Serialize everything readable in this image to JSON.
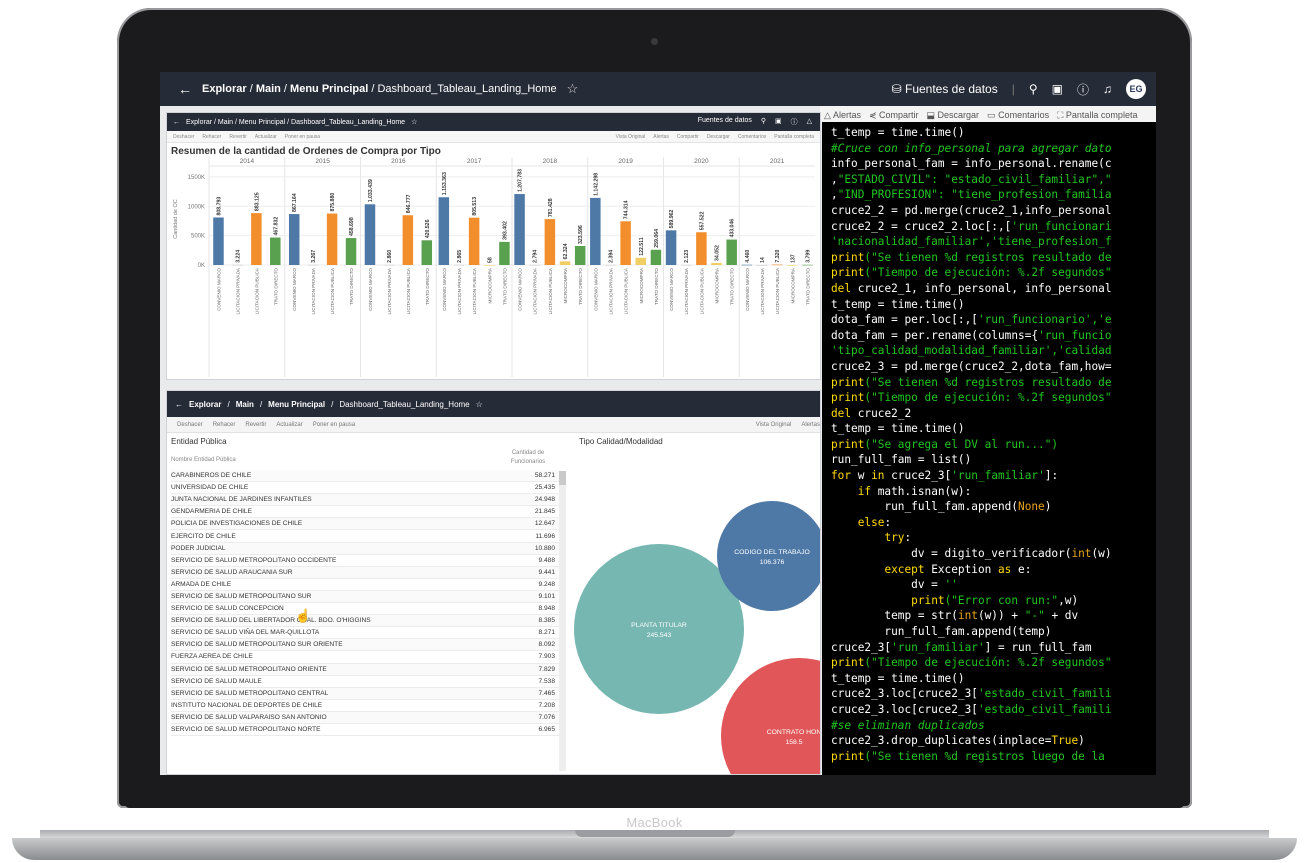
{
  "device": {
    "brand_label": "MacBook"
  },
  "topbar": {
    "breadcrumb": [
      "Explorar",
      "Main",
      "Menu Principal",
      "Dashboard_Tableau_Landing_Home"
    ],
    "data_sources": "Fuentes de datos",
    "avatar_initials": "EG"
  },
  "toolbar_right": [
    "Alertas",
    "Compartir",
    "Descargar",
    "Comentarios",
    "Pantalla completa"
  ],
  "panel1": {
    "topbar_crumb": "Explorar / Main / Menu Principal / Dashboard_Tableau_Landing_Home",
    "toolbar_left": [
      "Deshacer",
      "Rehacer",
      "Revertir",
      "Actualizar",
      "Poner en pausa"
    ],
    "toolbar_right": [
      "Vista Original",
      "Alertas",
      "Compartir",
      "Descargar",
      "Comentarios",
      "Pantalla completa"
    ],
    "data_sources": "Fuentes de datos"
  },
  "chart_data": {
    "type": "bar",
    "title": "Resumen de la cantidad de Ordenes de Compra por Tipo",
    "ylabel": "Cantidad de OC",
    "yticks": [
      "0K",
      "500K",
      "1000K",
      "1500K"
    ],
    "ylim": [
      0,
      1600000
    ],
    "colors": {
      "CONVENIO MARCO": "#4e79a7",
      "LICITACION PRIVADA": "#c9c9c9",
      "LICITACION PUBLICA": "#f28e2b",
      "TRATO DIRECTO": "#59a14f",
      "MICROCOMPRA": "#f1ce63"
    },
    "groups": [
      {
        "year": "2014",
        "bars": [
          {
            "cat": "CONVENIO MARCO",
            "value": 808793,
            "label": "808.793"
          },
          {
            "cat": "LICITACION PRIVADA",
            "value": 3224,
            "label": "3.224"
          },
          {
            "cat": "LICITACION PUBLICA",
            "value": 883125,
            "label": "883.125"
          },
          {
            "cat": "TRATO DIRECTO",
            "value": 467832,
            "label": "467.832"
          }
        ]
      },
      {
        "year": "2015",
        "bars": [
          {
            "cat": "CONVENIO MARCO",
            "value": 867164,
            "label": "867.164"
          },
          {
            "cat": "LICITACION PRIVADA",
            "value": 3267,
            "label": "3.267"
          },
          {
            "cat": "LICITACION PUBLICA",
            "value": 875880,
            "label": "875.880"
          },
          {
            "cat": "TRATO DIRECTO",
            "value": 458698,
            "label": "458.698"
          }
        ]
      },
      {
        "year": "2016",
        "bars": [
          {
            "cat": "CONVENIO MARCO",
            "value": 1033439,
            "label": "1.033.439"
          },
          {
            "cat": "LICITACION PRIVADA",
            "value": 2860,
            "label": "2.860"
          },
          {
            "cat": "LICITACION PUBLICA",
            "value": 846777,
            "label": "846.777"
          },
          {
            "cat": "TRATO DIRECTO",
            "value": 420526,
            "label": "420.526"
          }
        ]
      },
      {
        "year": "2017",
        "bars": [
          {
            "cat": "CONVENIO MARCO",
            "value": 1153363,
            "label": "1.153.363"
          },
          {
            "cat": "LICITACION PRIVADA",
            "value": 2865,
            "label": "2.865"
          },
          {
            "cat": "LICITACION PUBLICA",
            "value": 805513,
            "label": "805.513"
          },
          {
            "cat": "MICROCOMPRA",
            "value": 58,
            "label": "58"
          },
          {
            "cat": "TRATO DIRECTO",
            "value": 393402,
            "label": "393.402"
          }
        ]
      },
      {
        "year": "2018",
        "bars": [
          {
            "cat": "CONVENIO MARCO",
            "value": 1207783,
            "label": "1.207.783"
          },
          {
            "cat": "LICITACION PRIVADA",
            "value": 2794,
            "label": "2.794"
          },
          {
            "cat": "LICITACION PUBLICA",
            "value": 781428,
            "label": "781.428"
          },
          {
            "cat": "MICROCOMPRA",
            "value": 62324,
            "label": "62.324"
          },
          {
            "cat": "TRATO DIRECTO",
            "value": 323596,
            "label": "323.596"
          }
        ]
      },
      {
        "year": "2019",
        "bars": [
          {
            "cat": "CONVENIO MARCO",
            "value": 1142298,
            "label": "1.142.298"
          },
          {
            "cat": "LICITACION PRIVADA",
            "value": 2394,
            "label": "2.394"
          },
          {
            "cat": "LICITACION PUBLICA",
            "value": 744314,
            "label": "744.314"
          },
          {
            "cat": "MICROCOMPRA",
            "value": 122511,
            "label": "122.511"
          },
          {
            "cat": "TRATO DIRECTO",
            "value": 259064,
            "label": "259.064"
          }
        ]
      },
      {
        "year": "2020",
        "bars": [
          {
            "cat": "CONVENIO MARCO",
            "value": 589962,
            "label": "589.962"
          },
          {
            "cat": "LICITACION PRIVADA",
            "value": 2123,
            "label": "2.123"
          },
          {
            "cat": "LICITACION PUBLICA",
            "value": 557522,
            "label": "557.522"
          },
          {
            "cat": "MICROCOMPRA",
            "value": 34052,
            "label": "34.052"
          },
          {
            "cat": "TRATO DIRECTO",
            "value": 433046,
            "label": "433.046"
          }
        ]
      },
      {
        "year": "2021",
        "bars": [
          {
            "cat": "CONVENIO MARCO",
            "value": 4460,
            "label": "4.460"
          },
          {
            "cat": "LICITACION PRIVADA",
            "value": 14,
            "label": "14"
          },
          {
            "cat": "LICITACION PUBLICA",
            "value": 7320,
            "label": "7.320"
          },
          {
            "cat": "MICROCOMPRA",
            "value": 137,
            "label": "137"
          },
          {
            "cat": "TRATO DIRECTO",
            "value": 3799,
            "label": "3.799"
          }
        ]
      }
    ]
  },
  "panel2": {
    "topbar_crumb": [
      "Explorar",
      "Main",
      "Menu Principal",
      "Dashboard_Tableau_Landing_Home"
    ],
    "toolbar_left": [
      "Deshacer",
      "Rehacer",
      "Revertir",
      "Actualizar",
      "Poner en pausa"
    ],
    "toolbar_right": [
      "Vista Original",
      "Alertas"
    ],
    "entity_title": "Entidad Pública",
    "col_name": "Nombre Entidad Pública",
    "col_count": "Cantidad de Funcionarios",
    "tipo_title": "Tipo Calidad/Modalidad",
    "rows": [
      {
        "name": "CARABINEROS DE CHILE",
        "count": "58.271"
      },
      {
        "name": "UNIVERSIDAD DE CHILE",
        "count": "25.435"
      },
      {
        "name": "JUNTA NACIONAL DE JARDINES INFANTILES",
        "count": "24.948"
      },
      {
        "name": "GENDARMERIA DE CHILE",
        "count": "21.845"
      },
      {
        "name": "POLICIA DE INVESTIGACIONES DE CHILE",
        "count": "12.647"
      },
      {
        "name": "EJERCITO DE CHILE",
        "count": "11.696"
      },
      {
        "name": "PODER JUDICIAL",
        "count": "10.880"
      },
      {
        "name": "SERVICIO DE SALUD METROPOLITANO OCCIDENTE",
        "count": "9.488"
      },
      {
        "name": "SERVICIO DE SALUD ARAUCANIA SUR",
        "count": "9.441"
      },
      {
        "name": "ARMADA DE CHILE",
        "count": "9.248"
      },
      {
        "name": "SERVICIO DE SALUD METROPOLITANO SUR",
        "count": "9.101"
      },
      {
        "name": "SERVICIO DE SALUD CONCEPCION",
        "count": "8.948"
      },
      {
        "name": "SERVICIO DE SALUD DEL LIBERTADOR GRAL. BDO. O'HIGGINS",
        "count": "8.385"
      },
      {
        "name": "SERVICIO DE SALUD VIÑA DEL MAR-QUILLOTA",
        "count": "8.271"
      },
      {
        "name": "SERVICIO DE SALUD METROPOLITANO SUR ORIENTE",
        "count": "8.092"
      },
      {
        "name": "FUERZA AEREA DE CHILE",
        "count": "7.903"
      },
      {
        "name": "SERVICIO DE SALUD METROPOLITANO ORIENTE",
        "count": "7.829"
      },
      {
        "name": "SERVICIO DE SALUD MAULE",
        "count": "7.538"
      },
      {
        "name": "SERVICIO DE SALUD METROPOLITANO CENTRAL",
        "count": "7.465"
      },
      {
        "name": "INSTITUTO NACIONAL DE DEPORTES DE CHILE",
        "count": "7.208"
      },
      {
        "name": "SERVICIO DE SALUD VALPARAISO SAN ANTONIO",
        "count": "7.076"
      },
      {
        "name": "SERVICIO DE SALUD METROPOLITANO NORTE",
        "count": "6.965"
      }
    ],
    "bubbles": [
      {
        "label": "PLANTA TITULAR",
        "value": "245.543",
        "color": "#76b7b2"
      },
      {
        "label": "CODIGO DEL TRABAJO",
        "value": "106.376",
        "color": "#4e79a7"
      },
      {
        "label": "CONTRATO HON",
        "value": "158.5",
        "color": "#e15759"
      }
    ]
  },
  "code": [
    [
      [
        "",
        "t_temp = time.time()"
      ]
    ],
    [
      [
        "c",
        "#Cruce con info_personal para agregar dato"
      ]
    ],
    [
      [
        "",
        "info_personal_fam = info_personal.rename(c"
      ]
    ],
    [
      [
        "",
        ","
      ],
      [
        "s",
        "\"ESTADO_CIVIL\": \"estado_civil_familiar\",\""
      ]
    ],
    [
      [
        "",
        ","
      ],
      [
        "s",
        "\"IND_PROFESION\": \"tiene_profesion_familia"
      ]
    ],
    [
      [
        "",
        "cruce2_2 = pd.merge(cruce2_1,info_personal"
      ]
    ],
    [
      [
        "",
        "cruce2_2 = cruce2_2.loc[:,["
      ],
      [
        "s",
        "'run_funcionari"
      ]
    ],
    [
      [
        "s",
        "'nacionalidad_familiar','tiene_profesion_f"
      ]
    ],
    [
      [
        "k",
        "print"
      ],
      [
        "s",
        "(\"Se tienen %d registros resultado de"
      ]
    ],
    [
      [
        "k",
        "print"
      ],
      [
        "s",
        "(\"Tiempo de ejecución: %.2f segundos\""
      ]
    ],
    [
      [
        "k",
        "del"
      ],
      [
        "",
        " cruce2_1, info_personal, info_personal"
      ]
    ],
    [
      [
        "",
        "t_temp = time.time()"
      ]
    ],
    [
      [
        "",
        "dota_fam = per.loc[:,["
      ],
      [
        "s",
        "'run_funcionario','e"
      ]
    ],
    [
      [
        "",
        "dota_fam = per.rename(columns={"
      ],
      [
        "s",
        "'run_funcio"
      ]
    ],
    [
      [
        "s",
        "'tipo_calidad_modalidad_familiar','calidad"
      ]
    ],
    [
      [
        "",
        "cruce2_3 = pd.merge(cruce2_2,dota_fam,how="
      ]
    ],
    [
      [
        "k",
        "print"
      ],
      [
        "s",
        "(\"Se tienen %d registros resultado de"
      ]
    ],
    [
      [
        "k",
        "print"
      ],
      [
        "s",
        "(\"Tiempo de ejecución: %.2f segundos\""
      ]
    ],
    [
      [
        "k",
        "del"
      ],
      [
        "",
        " cruce2_2"
      ]
    ],
    [
      [
        "",
        "t_temp = time.time()"
      ]
    ],
    [
      [
        "k",
        "print"
      ],
      [
        "s",
        "(\"Se agrega el DV al run...\")"
      ]
    ],
    [
      [
        "",
        "run_full_fam = list()"
      ]
    ],
    [
      [
        "k",
        "for"
      ],
      [
        "",
        " w "
      ],
      [
        "k",
        "in"
      ],
      [
        "",
        " cruce2_3["
      ],
      [
        "s",
        "'run_familiar'"
      ],
      [
        "",
        "]:"
      ]
    ],
    [
      [
        "",
        "    "
      ],
      [
        "k",
        "if"
      ],
      [
        "",
        " math.isnan(w):"
      ]
    ],
    [
      [
        "",
        "        run_full_fam.append("
      ],
      [
        "p",
        "None"
      ],
      [
        "",
        ")"
      ]
    ],
    [
      [
        "",
        "    "
      ],
      [
        "k",
        "else"
      ],
      [
        "",
        ":"
      ]
    ],
    [
      [
        "",
        "        "
      ],
      [
        "k",
        "try"
      ],
      [
        "",
        ":"
      ]
    ],
    [
      [
        "",
        "            dv = digito_verificador("
      ],
      [
        "p",
        "int"
      ],
      [
        "",
        "(w)"
      ]
    ],
    [
      [
        "",
        "        "
      ],
      [
        "k",
        "except"
      ],
      [
        "",
        " Exception "
      ],
      [
        "k",
        "as"
      ],
      [
        "",
        " e:"
      ]
    ],
    [
      [
        "",
        "            dv = "
      ],
      [
        "s",
        "''"
      ]
    ],
    [
      [
        "",
        "            "
      ],
      [
        "k",
        "print"
      ],
      [
        "s",
        "(\"Error con run:\""
      ],
      [
        "",
        ",w)"
      ]
    ],
    [
      [
        "",
        "        temp = str("
      ],
      [
        "p",
        "int"
      ],
      [
        "",
        "(w)) + "
      ],
      [
        "s",
        "\"-\""
      ],
      [
        "",
        " + dv"
      ]
    ],
    [
      [
        "",
        "        run_full_fam.append(temp)"
      ]
    ],
    [
      [
        "",
        "cruce2_3["
      ],
      [
        "s",
        "'run_familiar'"
      ],
      [
        "",
        "] = run_full_fam"
      ]
    ],
    [
      [
        "k",
        "print"
      ],
      [
        "s",
        "(\"Tiempo de ejecución: %.2f segundos\""
      ]
    ],
    [
      [
        "",
        "t_temp = time.time()"
      ]
    ],
    [
      [
        "",
        "cruce2_3.loc[cruce2_3["
      ],
      [
        "s",
        "'estado_civil_famili"
      ]
    ],
    [
      [
        "",
        "cruce2_3.loc[cruce2_3["
      ],
      [
        "s",
        "'estado_civil_famili"
      ]
    ],
    [
      [
        "c",
        "#se eliminan duplicados"
      ]
    ],
    [
      [
        "",
        "cruce2_3.drop_duplicates(inplace="
      ],
      [
        "k",
        "True"
      ],
      [
        "",
        ")"
      ]
    ],
    [
      [
        "k",
        "print"
      ],
      [
        "s",
        "(\"Se tienen %d registros luego de la"
      ]
    ]
  ]
}
